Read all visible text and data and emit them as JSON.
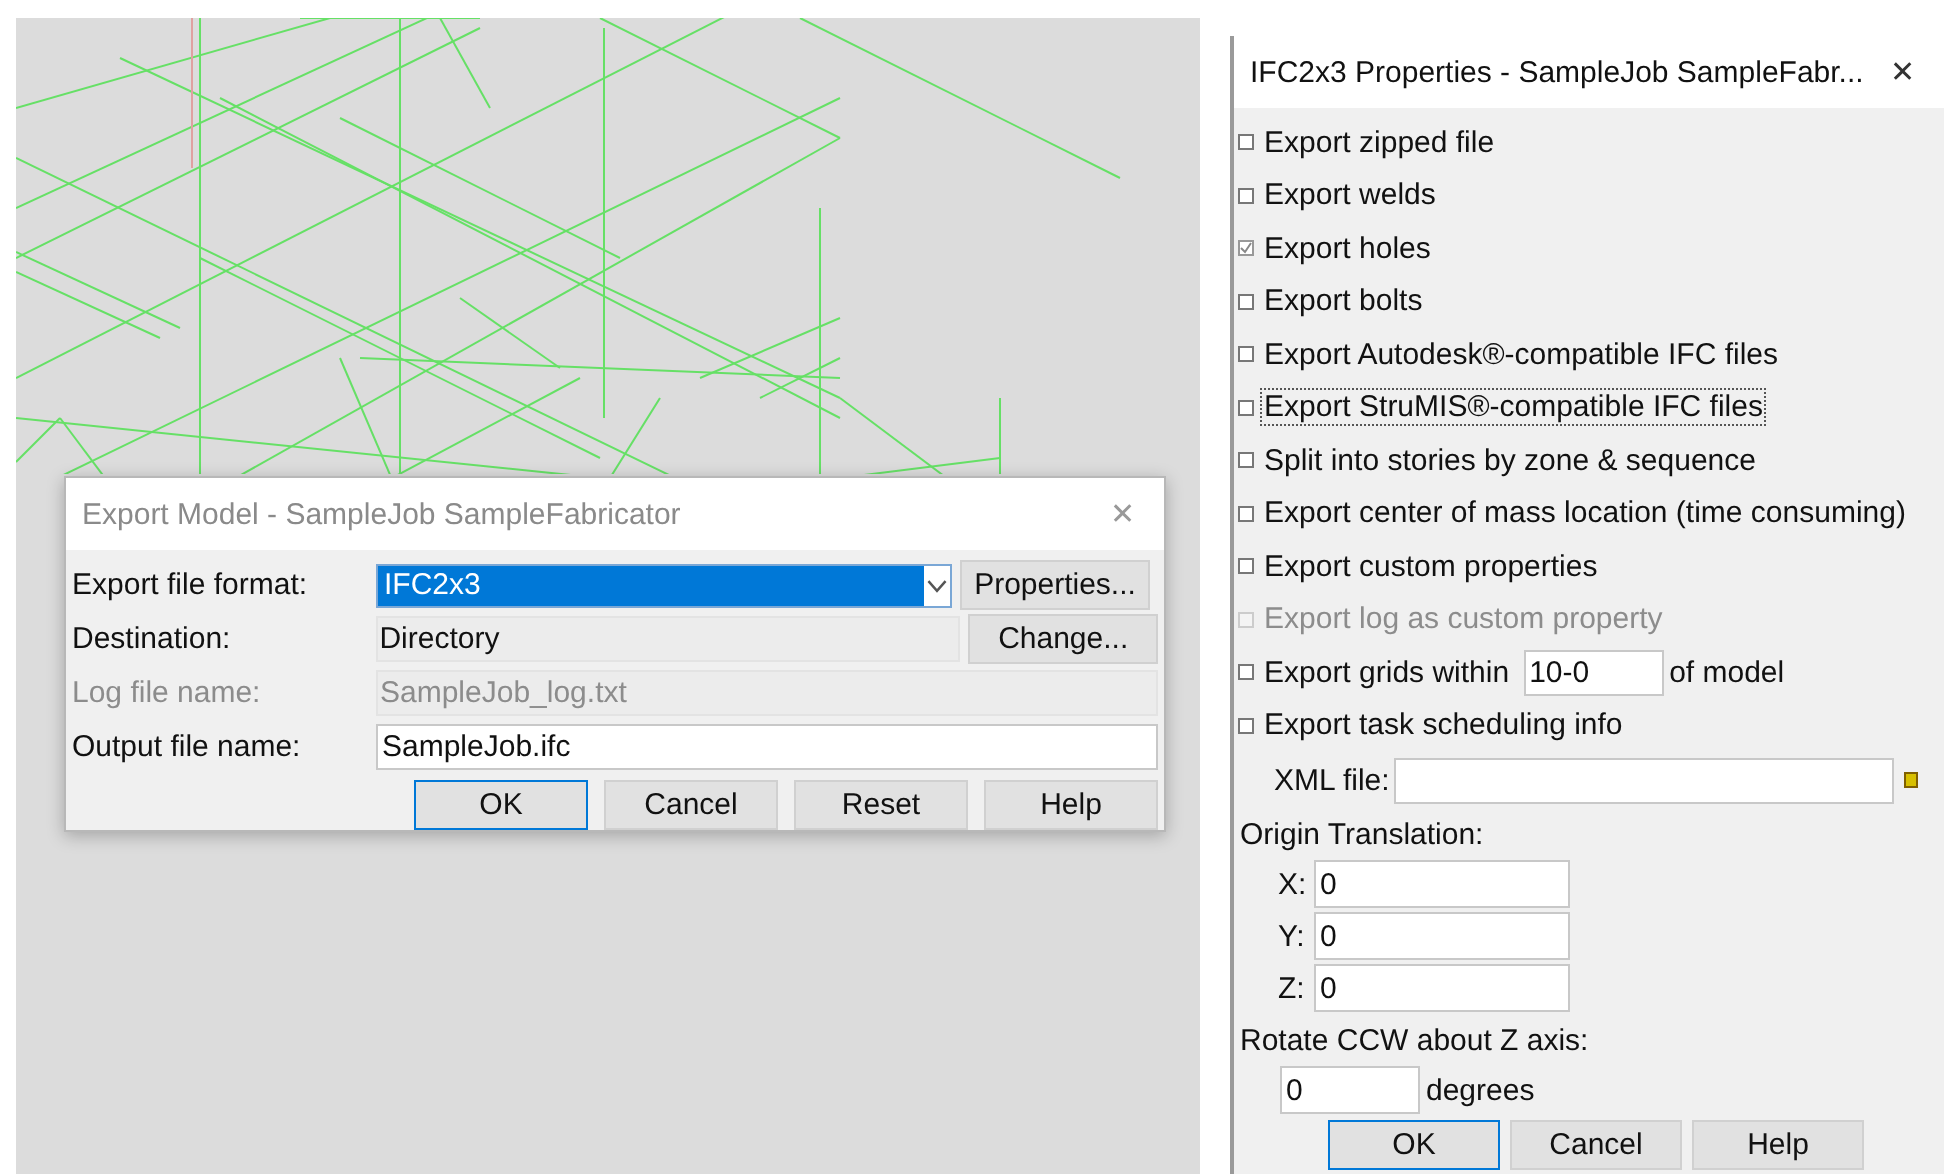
{
  "export_dialog": {
    "title": "Export Model - SampleJob SampleFabricator",
    "close": "✕",
    "rows": [
      {
        "kind": "dropdown",
        "label": "Export file format:",
        "value": "IFC2x3",
        "disabled": false,
        "button": "Properties..."
      },
      {
        "kind": "readonly",
        "label": "Destination:",
        "value": "Directory",
        "disabled": false,
        "button": "Change..."
      },
      {
        "kind": "readonly",
        "label": "Log file name:",
        "value": "SampleJob_log.txt",
        "disabled": true
      },
      {
        "kind": "text",
        "label": "Output file name:",
        "value": "SampleJob.ifc",
        "disabled": false
      }
    ],
    "buttons": [
      {
        "label": "OK",
        "selected": true
      },
      {
        "label": "Cancel",
        "selected": false
      },
      {
        "label": "Reset",
        "selected": false
      },
      {
        "label": "Help",
        "selected": false
      }
    ]
  },
  "properties_dialog": {
    "title": "IFC2x3 Properties - SampleJob SampleFabr...",
    "close": "✕",
    "options": [
      {
        "kind": "checkbox",
        "label": "Export zipped file",
        "checked": false,
        "disabled": false,
        "focused": false
      },
      {
        "kind": "checkbox",
        "label": "Export welds",
        "checked": false,
        "disabled": false,
        "focused": false
      },
      {
        "kind": "checkbox",
        "label": "Export holes",
        "checked": true,
        "disabled": false,
        "focused": false
      },
      {
        "kind": "checkbox",
        "label": "Export bolts",
        "checked": false,
        "disabled": false,
        "focused": false
      },
      {
        "kind": "checkbox",
        "label": "Export Autodesk®-compatible IFC files",
        "checked": false,
        "disabled": false,
        "focused": false
      },
      {
        "kind": "checkbox",
        "label": "Export StruMIS®-compatible IFC files",
        "checked": false,
        "disabled": false,
        "focused": true
      },
      {
        "kind": "checkbox",
        "label": "Split into stories by zone & sequence",
        "checked": false,
        "disabled": false,
        "focused": false
      },
      {
        "kind": "checkbox",
        "label": "Export center of mass location (time consuming)",
        "checked": false,
        "disabled": false,
        "focused": false
      },
      {
        "kind": "checkbox",
        "label": "Export custom properties",
        "checked": false,
        "disabled": false,
        "focused": false
      },
      {
        "kind": "checkbox",
        "label": "Export log as custom property",
        "checked": false,
        "disabled": true,
        "focused": false
      },
      {
        "kind": "checkbox_field",
        "label": "Export grids within",
        "value": "10-0",
        "suffix": "of model",
        "checked": false,
        "disabled": false,
        "focused": false
      },
      {
        "kind": "checkbox",
        "label": "Export task scheduling info",
        "checked": false,
        "disabled": false,
        "focused": false
      }
    ],
    "xml_file": {
      "label": "XML file:"
    },
    "origin_translation": {
      "label": "Origin Translation:",
      "fields": [
        {
          "label": "X:",
          "value": "0"
        },
        {
          "label": "Y:",
          "value": "0"
        },
        {
          "label": "Z:",
          "value": "0"
        }
      ]
    },
    "rotate": {
      "label": "Rotate CCW about Z axis:",
      "value": "0",
      "unit": "degrees"
    },
    "buttons": [
      {
        "label": "OK",
        "selected": true
      },
      {
        "label": "Cancel",
        "selected": false
      },
      {
        "label": "Help",
        "selected": false
      }
    ]
  }
}
